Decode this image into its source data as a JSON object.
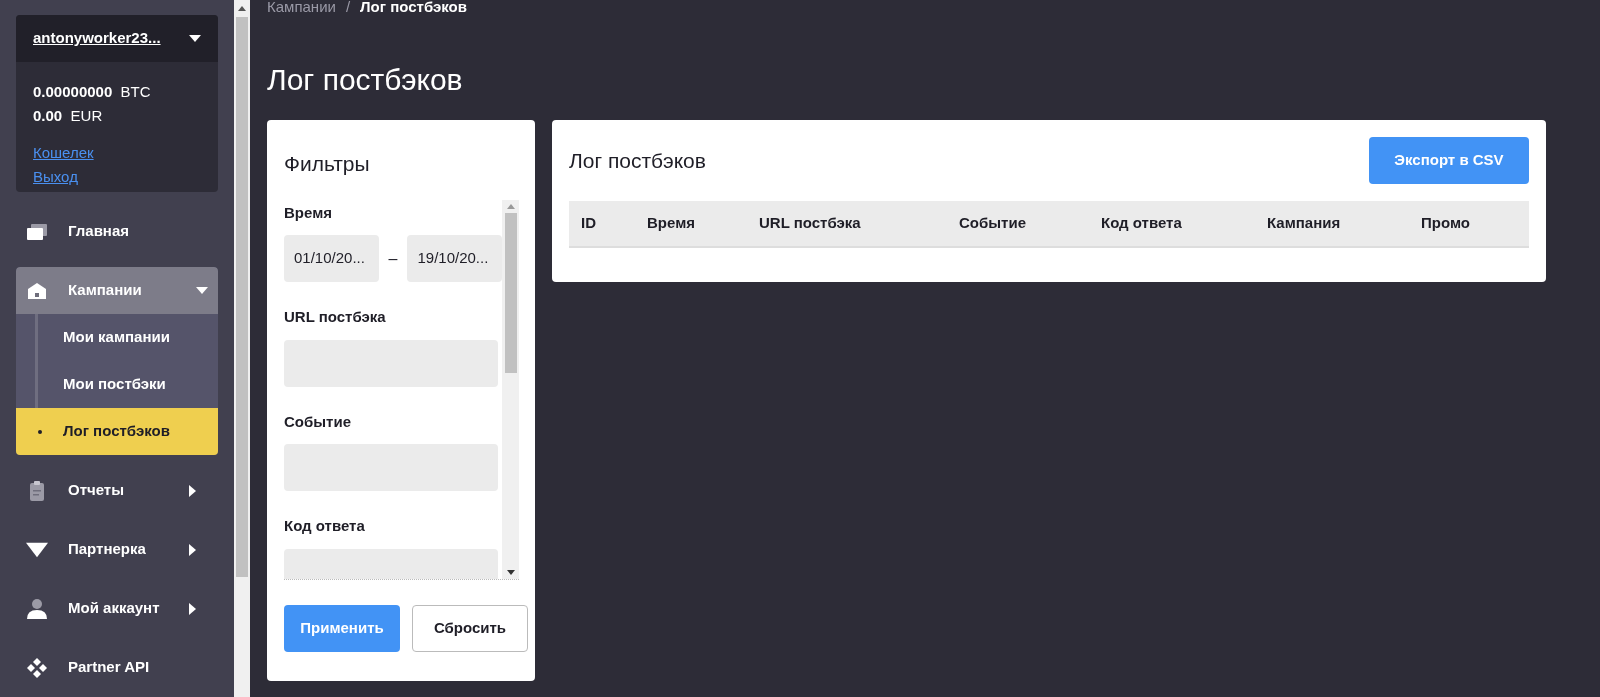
{
  "account": {
    "username": "antonyworker23...",
    "balances": [
      {
        "amount": "0.00000000",
        "currency": "BTC"
      },
      {
        "amount": "0.00",
        "currency": "EUR"
      }
    ],
    "links": [
      "Кошелек",
      "Выход"
    ]
  },
  "sidebar": {
    "items": [
      {
        "label": "Главная"
      },
      {
        "label": "Кампании",
        "expanded": true,
        "children": [
          {
            "label": "Мои кампании",
            "selected": false
          },
          {
            "label": "Мои постбэки",
            "selected": false
          },
          {
            "label": "Лог постбэков",
            "selected": true
          }
        ]
      },
      {
        "label": "Отчеты",
        "expanded": false
      },
      {
        "label": "Партнерка",
        "expanded": false
      },
      {
        "label": "Мой аккаунт",
        "expanded": false
      },
      {
        "label": "Partner API"
      }
    ]
  },
  "breadcrumb": [
    "Кампании",
    "/",
    "Лог постбэков"
  ],
  "page_title": "Лог постбэков",
  "filters": {
    "title": "Фильтры",
    "fields": [
      {
        "kind": "date_range",
        "label": "Время",
        "from": "01/10/20...",
        "separator": "–",
        "to": "19/10/20..."
      },
      {
        "kind": "text",
        "label": "URL постбэка"
      },
      {
        "kind": "text",
        "label": "Событие"
      },
      {
        "kind": "text",
        "label": "Код ответа"
      }
    ],
    "buttons": [
      {
        "label": "Применить",
        "primary": true
      },
      {
        "label": "Сбросить",
        "primary": false
      }
    ]
  },
  "log": {
    "title": "Лог постбэков",
    "export_button": "Экспорт в CSV",
    "columns": [
      "ID",
      "Время",
      "URL постбэка",
      "Событие",
      "Код ответа",
      "Кампания",
      "Промо"
    ]
  }
}
